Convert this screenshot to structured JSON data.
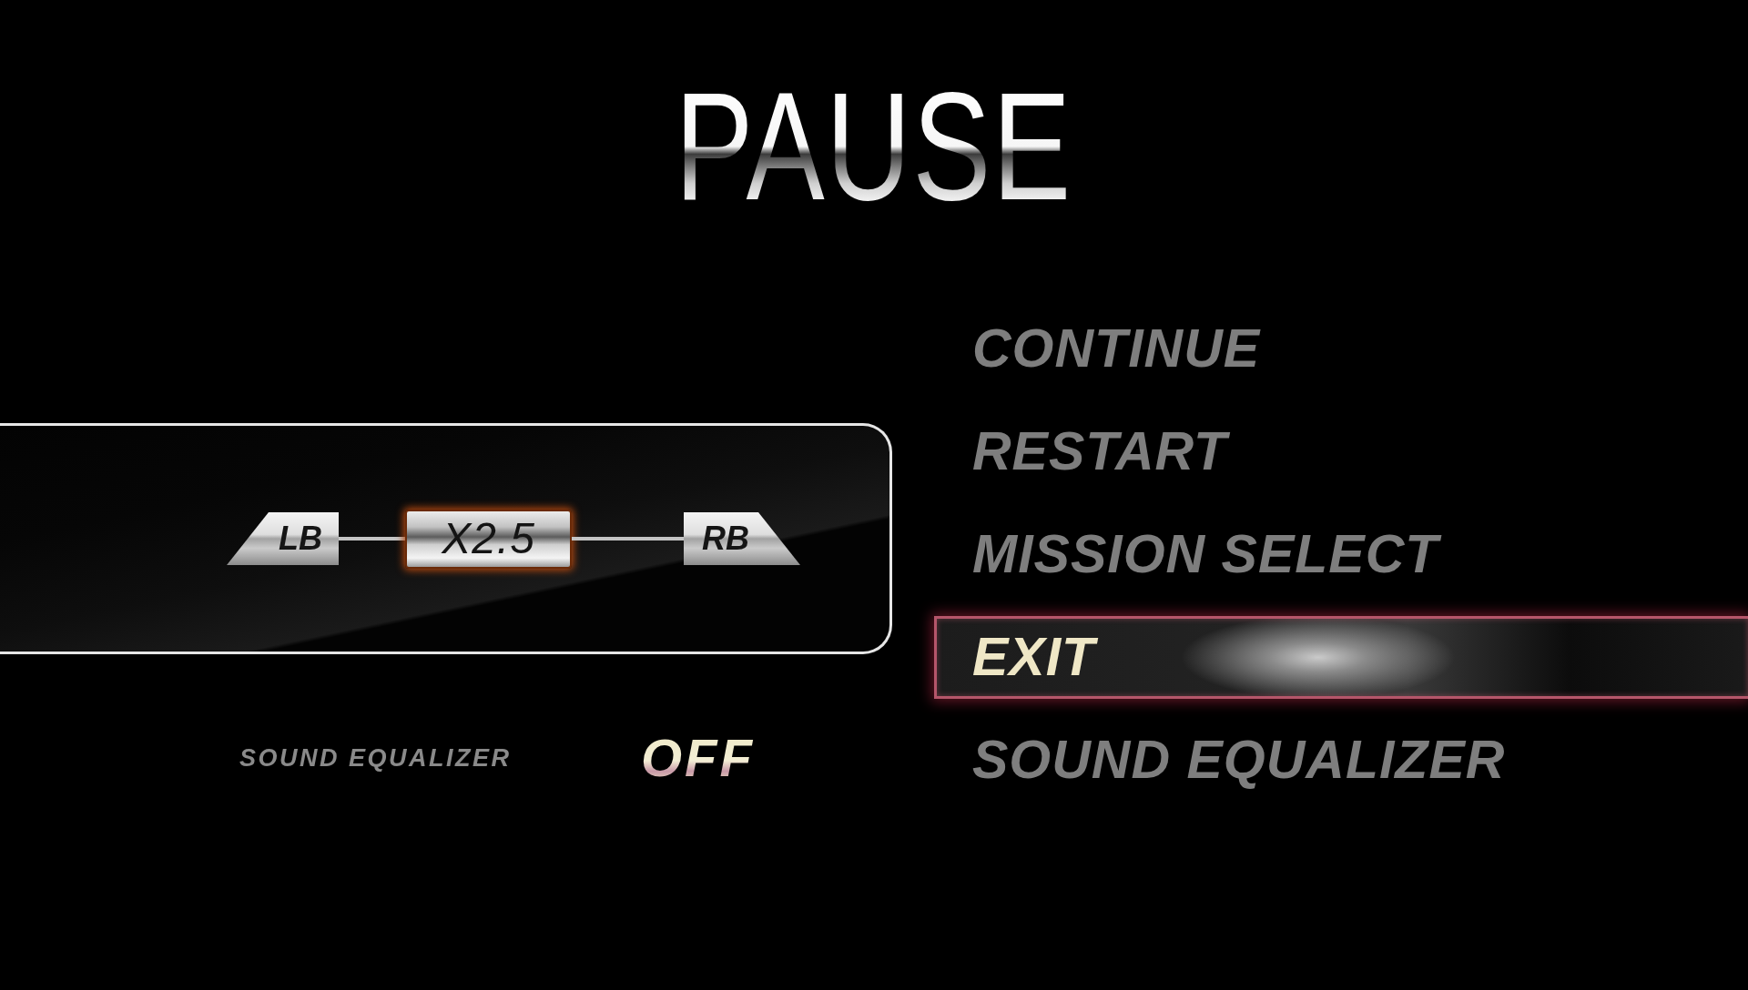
{
  "title": "PAUSE",
  "selector": {
    "left_button": "LB",
    "value": "X2.5",
    "right_button": "RB"
  },
  "setting": {
    "label": "SOUND EQUALIZER",
    "value": "OFF"
  },
  "menu": [
    {
      "label": "CONTINUE",
      "selected": false
    },
    {
      "label": "RESTART",
      "selected": false
    },
    {
      "label": "MISSION SELECT",
      "selected": false
    },
    {
      "label": "EXIT",
      "selected": true
    },
    {
      "label": "SOUND EQUALIZER",
      "selected": false
    }
  ]
}
